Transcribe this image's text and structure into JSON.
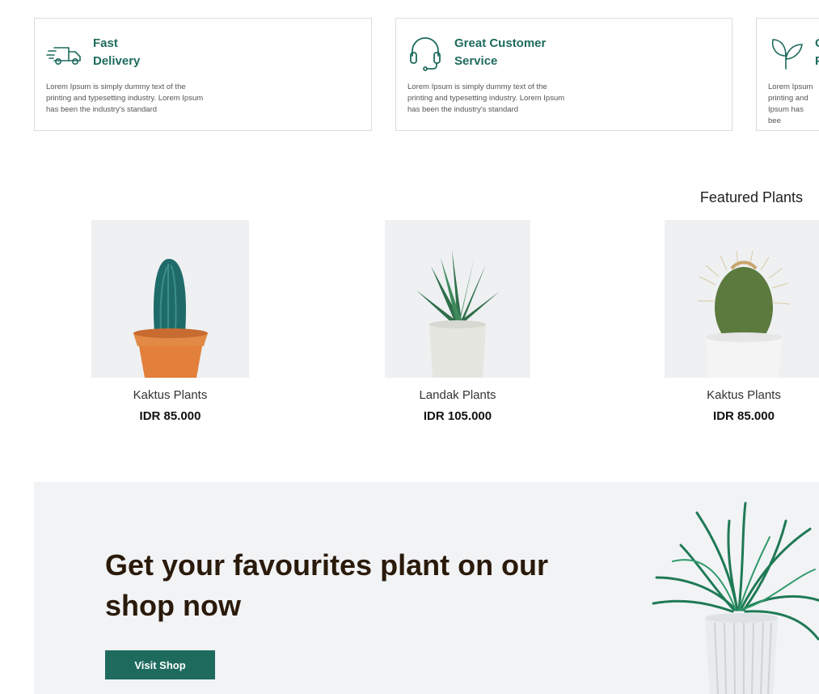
{
  "features": [
    {
      "icon": "delivery-truck-icon",
      "title": "Fast\nDelivery",
      "text": "Lorem Ipsum is simply dummy text of the printing and typesetting industry. Lorem Ipsum has been the industry's standard"
    },
    {
      "icon": "headset-icon",
      "title": "Great Customer\nService",
      "text": "Lorem Ipsum is simply dummy text of the printing and typesetting industry. Lorem Ipsum has been the industry's standard"
    },
    {
      "icon": "leaves-icon",
      "title": "O\nP",
      "text": "Lorem Ipsum printing and Ipsum has bee"
    }
  ],
  "featured": {
    "title": "Featured Plants",
    "products": [
      {
        "name": "Kaktus Plants",
        "price": "IDR 85.000"
      },
      {
        "name": "Landak Plants",
        "price": "IDR 105.000"
      },
      {
        "name": "Kaktus Plants",
        "price": "IDR 85.000"
      }
    ]
  },
  "banner": {
    "heading": "Get your favourites plant on our shop now",
    "button_label": "Visit Shop"
  },
  "colors": {
    "brand_green": "#1e6b5e",
    "banner_bg": "#f2f3f5",
    "heading_brown": "#2a1a0a"
  }
}
